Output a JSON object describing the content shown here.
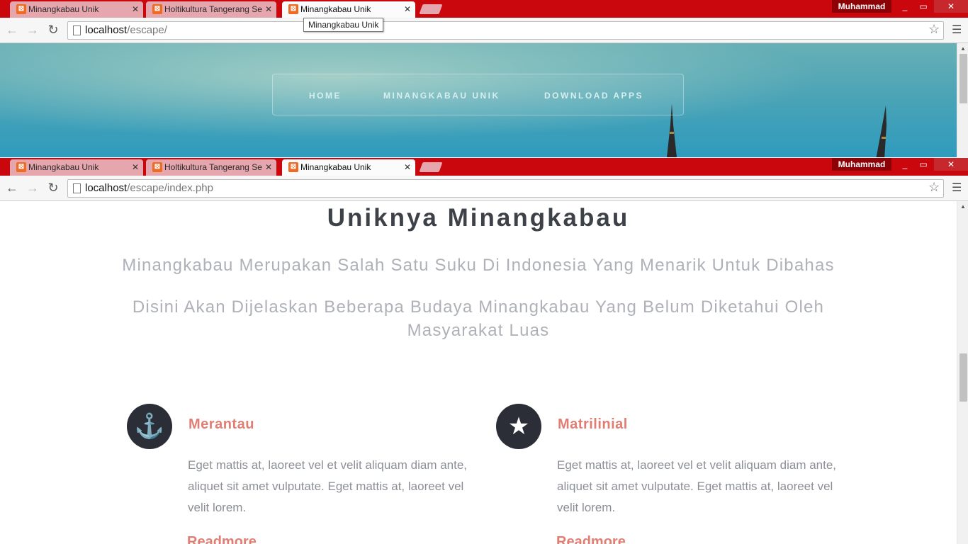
{
  "browser": {
    "tabs": [
      {
        "title": "Minangkabau Unik"
      },
      {
        "title": "Holtikultura Tangerang Se"
      },
      {
        "title": "Minangkabau Unik"
      }
    ],
    "profile_name": "Muhammad",
    "tooltip": "Minangkabau Unik"
  },
  "window_top": {
    "url_host": "localhost",
    "url_path": "/escape/"
  },
  "window_bottom": {
    "url_host": "localhost",
    "url_path": "/escape/index.php"
  },
  "hero": {
    "nav": [
      "HOME",
      "MINANGKABAU UNIK",
      "DOWNLOAD APPS"
    ]
  },
  "main": {
    "title": "Uniknya Minangkabau",
    "lead1": "Minangkabau Merupakan Salah Satu Suku Di Indonesia Yang Menarik Untuk Dibahas",
    "lead2": "Disini Akan Dijelaskan Beberapa Budaya Minangkabau Yang Belum Diketahui Oleh Masyarakat Luas",
    "features": [
      {
        "icon": "anchor-icon",
        "title": "Merantau",
        "body": "Eget mattis at, laoreet vel et velit aliquam diam ante, aliquet sit amet vulputate. Eget mattis at, laoreet vel velit lorem.",
        "more": "Readmore"
      },
      {
        "icon": "star-icon",
        "title": "Matrilinial",
        "body": "Eget mattis at, laoreet vel et velit aliquam diam ante, aliquet sit amet vulputate. Eget mattis at, laoreet vel velit lorem.",
        "more": "Readmore"
      }
    ]
  },
  "colors": {
    "tabbar": "#c9070d",
    "accent": "#e07e74",
    "icon_bg": "#2b2e36"
  }
}
